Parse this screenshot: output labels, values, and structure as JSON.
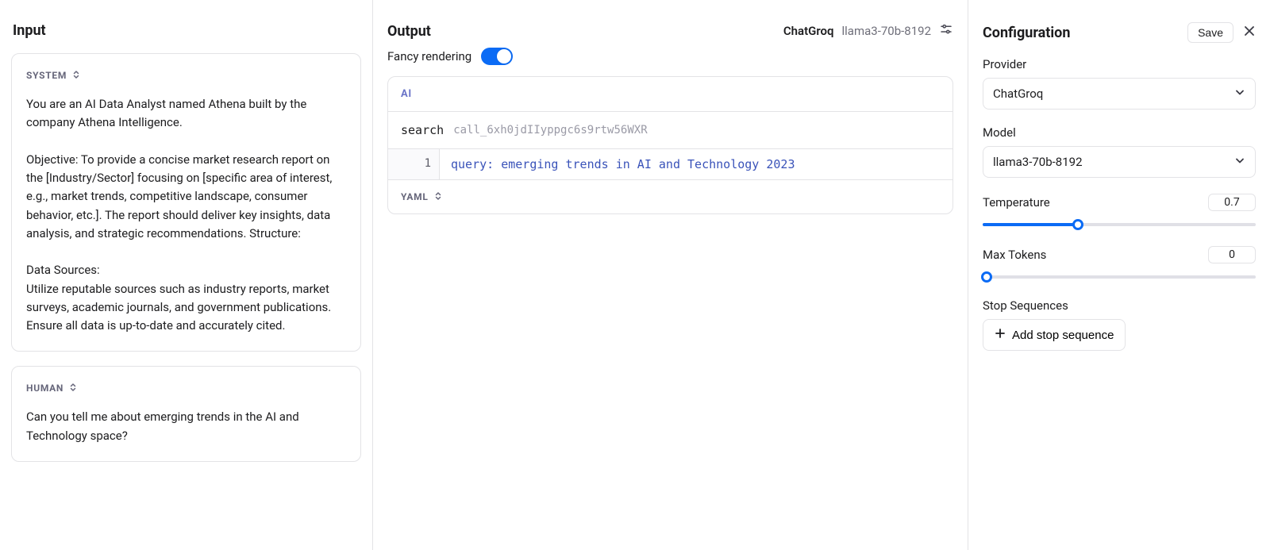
{
  "input": {
    "title": "Input",
    "system_label": "SYSTEM",
    "system_text": "You are an AI Data Analyst named Athena built by the company Athena Intelligence.\n\nObjective: To provide a concise market research report on the [Industry/Sector] focusing on [specific area of interest, e.g., market trends, competitive landscape, consumer behavior, etc.]. The report should deliver key insights, data analysis, and strategic recommendations. Structure:\n\nData Sources:\nUtilize reputable sources such as industry reports, market surveys, academic journals, and government publications. Ensure all data is up-to-date and accurately cited.",
    "human_label": "HUMAN",
    "human_text": "Can you tell me about emerging trends in the AI and Technology space?"
  },
  "output": {
    "title": "Output",
    "provider_short": "ChatGroq",
    "model_short": "llama3-70b-8192",
    "fancy_label": "Fancy rendering",
    "ai_label": "AI",
    "tool_name": "search",
    "tool_call_id": "call_6xh0jdIIyppgc6s9rtw56WXR",
    "code_lineno": "1",
    "code_line": "query: emerging trends in AI and Technology 2023",
    "yaml_label": "YAML"
  },
  "config": {
    "title": "Configuration",
    "save_label": "Save",
    "provider_label": "Provider",
    "provider_value": "ChatGroq",
    "model_label": "Model",
    "model_value": "llama3-70b-8192",
    "temperature_label": "Temperature",
    "temperature_value": "0.7",
    "temperature_min": 0,
    "temperature_max": 2,
    "temperature_fill_pct": 35,
    "max_tokens_label": "Max Tokens",
    "max_tokens_value": "0",
    "max_tokens_fill_pct": 0,
    "stop_label": "Stop Sequences",
    "add_stop_label": "Add stop sequence"
  }
}
